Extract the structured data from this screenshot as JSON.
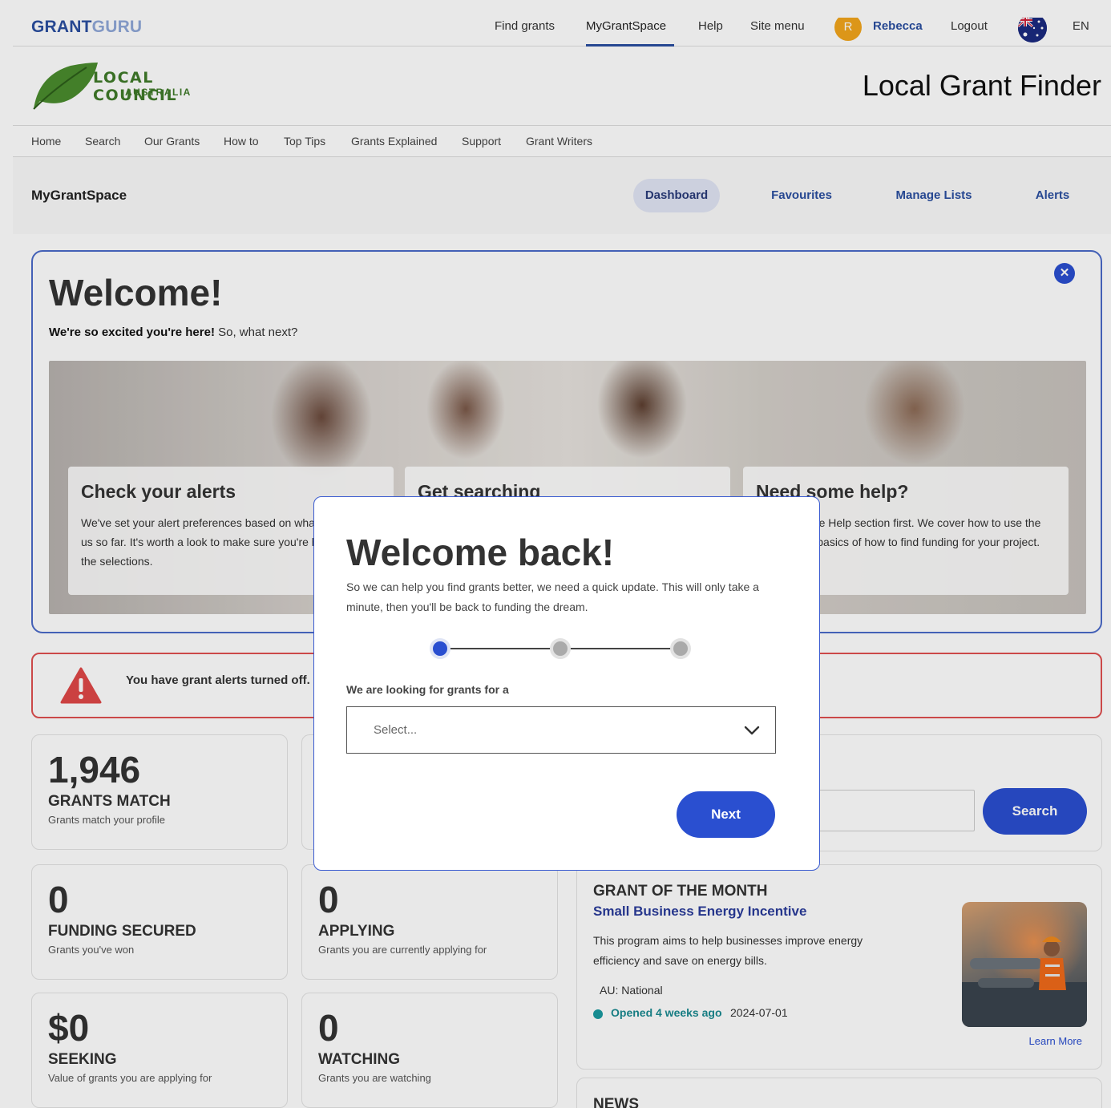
{
  "brand": {
    "part1": "GRANT",
    "part2": "GURU"
  },
  "topnav": [
    {
      "label": "Find grants"
    },
    {
      "label": "MyGrantSpace"
    },
    {
      "label": "Help"
    },
    {
      "label": "Site menu"
    }
  ],
  "user": {
    "initial": "R",
    "name": "Rebecca",
    "logout": "Logout",
    "language": "EN",
    "flag_icon": "australia-flag-icon"
  },
  "logo": {
    "line1": "LOCAL COUNCIL",
    "line2": "AUSTRALIA",
    "color": "#3f7a29"
  },
  "site_title": "Local Grant Finder",
  "mainnav": [
    "Home",
    "Search",
    "Our Grants",
    "How to",
    "Top Tips",
    "Grants Explained",
    "Support",
    "Grant Writers"
  ],
  "subbar": {
    "title": "MyGrantSpace",
    "tabs": [
      {
        "label": "Dashboard",
        "active": true
      },
      {
        "label": "Favourites"
      },
      {
        "label": "Manage Lists"
      },
      {
        "label": "Alerts"
      }
    ]
  },
  "welcome": {
    "title": "Welcome!",
    "sub_bold": "We're so excited you're here!",
    "sub_rest": " So, what next?",
    "cards": [
      {
        "title": "Check your alerts",
        "text": "We've set your alert preferences based on what you've told us so far. It's worth a look to make sure you're happy with the selections."
      },
      {
        "title": "Get searching",
        "text": ""
      },
      {
        "title": "Need some help?",
        "text": "Check out the Help section first. We cover how to use the site and the basics of how to find funding for your project."
      }
    ]
  },
  "alert": {
    "text": "You have grant alerts turned off."
  },
  "stats": [
    {
      "num": "1,946",
      "label": "GRANTS MATCH",
      "desc": "Grants match your profile"
    },
    {
      "num": "0",
      "label": "FUNDING SECURED",
      "desc": "Grants you've won"
    },
    {
      "num": "0",
      "label": "APPLYING",
      "desc": "Grants you are currently applying for"
    },
    {
      "num": "$0",
      "label": "SEEKING",
      "desc": "Value of grants you are applying for"
    },
    {
      "num": "0",
      "label": "WATCHING",
      "desc": "Grants you are watching"
    }
  ],
  "search": {
    "button": "Search"
  },
  "grant_of_month": {
    "title": "GRANT OF THE MONTH",
    "name": "Small Business Energy Incentive",
    "desc": "This program aims to help businesses improve energy efficiency and save on energy bills.",
    "region": "AU: National",
    "opened": "Opened 4 weeks ago",
    "date": "2024-07-01",
    "learn_more": "Learn More"
  },
  "news": {
    "title": "NEWS"
  },
  "modal": {
    "title": "Welcome back!",
    "subtitle": "So we can help you find grants better, we need a quick update. This will only take a minute, then you'll be back to funding the dream.",
    "steps": {
      "current": 1,
      "total": 3
    },
    "field_label": "We are looking for grants for a",
    "select_placeholder": "Select...",
    "next": "Next"
  },
  "colors": {
    "accent": "#2a4fd0",
    "brand": "#2a4fa0",
    "alert": "#e05050",
    "success": "#1a9aa0"
  }
}
